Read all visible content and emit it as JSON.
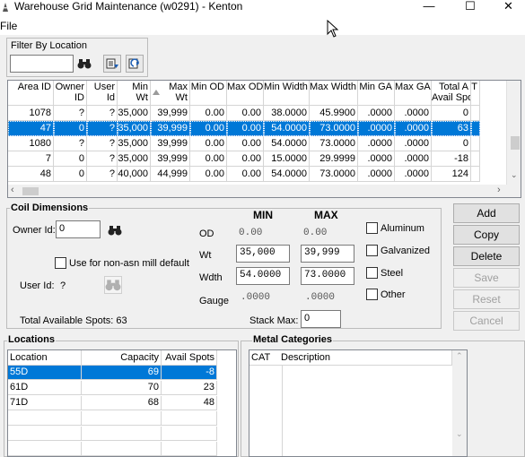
{
  "window": {
    "title": "Warehouse Grid Maintenance (w0291) - Kenton",
    "minimize": "—",
    "maximize": "☐",
    "close": "✕"
  },
  "menu": {
    "file": "File"
  },
  "filter": {
    "group_title": "Filter By Location",
    "value": ""
  },
  "grid": {
    "headers": [
      [
        "",
        "Area ID"
      ],
      [
        "Owner",
        "ID"
      ],
      [
        "User",
        "Id"
      ],
      [
        "Min",
        "Wt"
      ],
      [
        "Max",
        "Wt"
      ],
      [
        "",
        "Min OD"
      ],
      [
        "",
        "Max OD"
      ],
      [
        "",
        "Min Width"
      ],
      [
        "",
        "Max Width"
      ],
      [
        "",
        "Min GA"
      ],
      [
        "",
        "Max GA"
      ],
      [
        "Total A",
        "Avail Spots"
      ],
      [
        "",
        "T"
      ]
    ],
    "rows": [
      [
        "1078",
        "?",
        "?",
        "35,000",
        "39,999",
        "0.00",
        "0.00",
        "38.0000",
        "45.9900",
        ".0000",
        ".0000",
        "0",
        ""
      ],
      [
        "47",
        "0",
        "?",
        "35,000",
        "39,999",
        "0.00",
        "0.00",
        "54.0000",
        "73.0000",
        ".0000",
        ".0000",
        "63",
        ""
      ],
      [
        "1080",
        "?",
        "?",
        "35,000",
        "39,999",
        "0.00",
        "0.00",
        "54.0000",
        "73.0000",
        ".0000",
        ".0000",
        "0",
        ""
      ],
      [
        "7",
        "0",
        "?",
        "35,000",
        "39,999",
        "0.00",
        "0.00",
        "15.0000",
        "29.9999",
        ".0000",
        ".0000",
        "-18",
        ""
      ],
      [
        "48",
        "0",
        "?",
        "40,000",
        "44,999",
        "0.00",
        "0.00",
        "54.0000",
        "73.0000",
        ".0000",
        ".0000",
        "124",
        ""
      ]
    ],
    "selected_row": 1
  },
  "coil": {
    "group_title": "Coil Dimensions",
    "owner_label": "Owner Id:",
    "owner_value": "0",
    "nonasn_label": "Use for non-asn mill default",
    "userid_label": "User Id:",
    "userid_value": "?",
    "total_spots": "Total Available Spots: 63",
    "min_header": "MIN",
    "max_header": "MAX",
    "od_label": "OD",
    "od_min": "0.00",
    "od_max": "0.00",
    "wt_label": "Wt",
    "wt_min": "35,000",
    "wt_max": "39,999",
    "wdth_label": "Wdth",
    "wdth_min": "54.0000",
    "wdth_max": "73.0000",
    "gauge_label": "Gauge",
    "gauge_min": ".0000",
    "gauge_max": ".0000",
    "stack_label": "Stack Max:",
    "stack_value": "0",
    "metals": [
      "Aluminum",
      "Galvanized",
      "Steel",
      "Other"
    ]
  },
  "actions": [
    "Add",
    "Copy",
    "Delete",
    "Save",
    "Reset",
    "Cancel"
  ],
  "locations": {
    "group_title": "Locations",
    "headers": [
      "Location",
      "Capacity",
      "Avail Spots"
    ],
    "rows": [
      [
        "55D",
        "69",
        "-8"
      ],
      [
        "61D",
        "70",
        "23"
      ],
      [
        "71D",
        "68",
        "48"
      ]
    ]
  },
  "metal_categories": {
    "group_title": "Metal Categories",
    "headers": [
      "CAT",
      "Description"
    ]
  }
}
